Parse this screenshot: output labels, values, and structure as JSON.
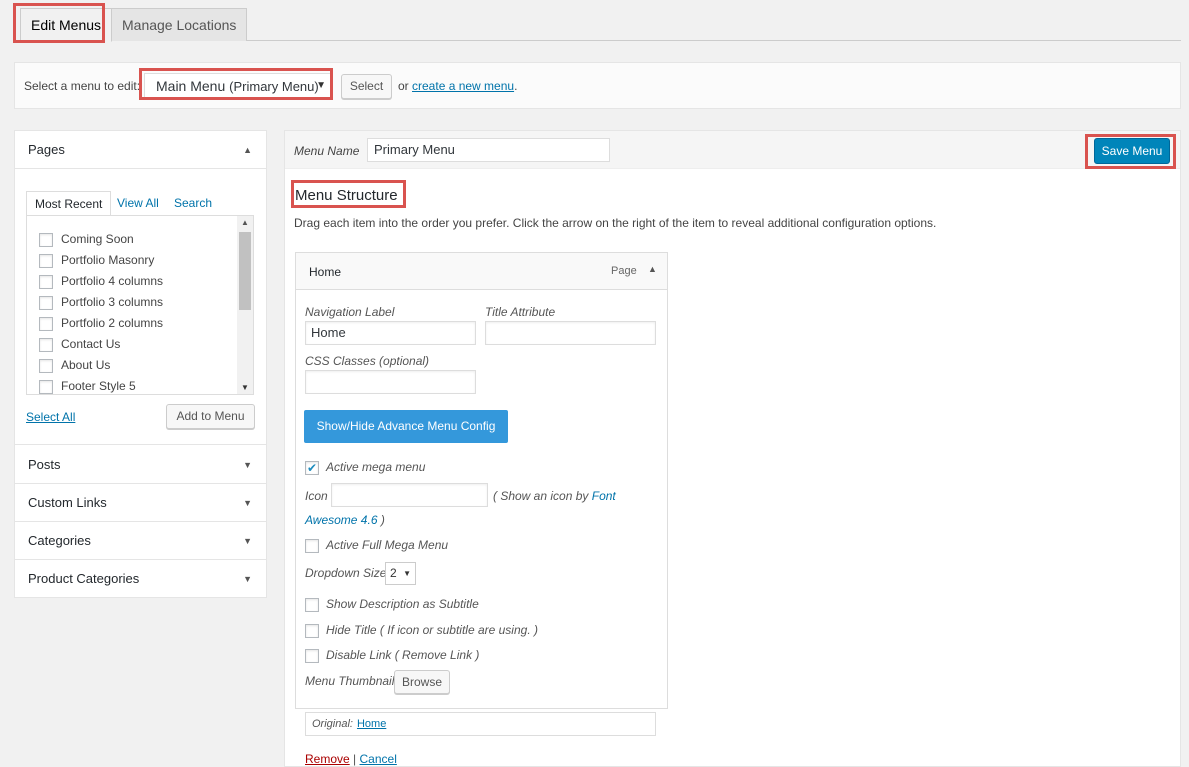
{
  "tabs": [
    {
      "label": "Edit Menus",
      "active": true
    },
    {
      "label": "Manage Locations",
      "active": false
    }
  ],
  "select_bar": {
    "label": "Select a menu to edit:",
    "selected_menu": "Main Menu",
    "selected_menu_location": "(Primary Menu)",
    "select_button": "Select",
    "or_text": "or",
    "create_link": "create a new menu",
    "period": "."
  },
  "left_panel": {
    "pages_title": "Pages",
    "sub_tabs": [
      "Most Recent",
      "View All",
      "Search"
    ],
    "pages": [
      "Coming Soon",
      "Portfolio Masonry",
      "Portfolio 4 columns",
      "Portfolio 3 columns",
      "Portfolio 2 columns",
      "Contact Us",
      "About Us",
      "Footer Style 5"
    ],
    "select_all": "Select All",
    "add_to_menu": "Add to Menu",
    "sections": [
      "Posts",
      "Custom Links",
      "Categories",
      "Product Categories"
    ]
  },
  "right_panel": {
    "menu_name_label": "Menu Name",
    "menu_name_value": "Primary Menu",
    "save_button": "Save Menu",
    "structure_title": "Menu Structure",
    "structure_desc": "Drag each item into the order you prefer. Click the arrow on the right of the item to reveal additional configuration options.",
    "item": {
      "title": "Home",
      "type": "Page",
      "nav_label_label": "Navigation Label",
      "nav_label_value": "Home",
      "title_attr_label": "Title Attribute",
      "title_attr_value": "",
      "css_label": "CSS Classes (optional)",
      "css_value": "",
      "advance_button": "Show/Hide Advance Menu Config",
      "active_mega": "Active mega menu",
      "icon_label": "Icon",
      "icon_note_prefix": "( Show an icon by",
      "icon_link_1": "Font",
      "icon_link_2": "Awesome 4.6",
      "icon_note_suffix": ")",
      "full_mega": "Active Full Mega Menu",
      "dropdown_label": "Dropdown Size",
      "dropdown_value": "2",
      "show_desc": "Show Description as Subtitle",
      "hide_title": "Hide Title ( If icon or subtitle are using. )",
      "disable_link": "Disable Link ( Remove Link )",
      "thumbnail_label": "Menu Thumbnail",
      "browse": "Browse",
      "original_label": "Original:",
      "original_link": "Home",
      "remove": "Remove",
      "separator": "|",
      "cancel": "Cancel"
    }
  },
  "colors": {
    "highlight": "#d9534f",
    "primary_button": "#0085ba",
    "advance_button": "#3498db",
    "link": "#0073aa",
    "remove": "#aa0000"
  }
}
